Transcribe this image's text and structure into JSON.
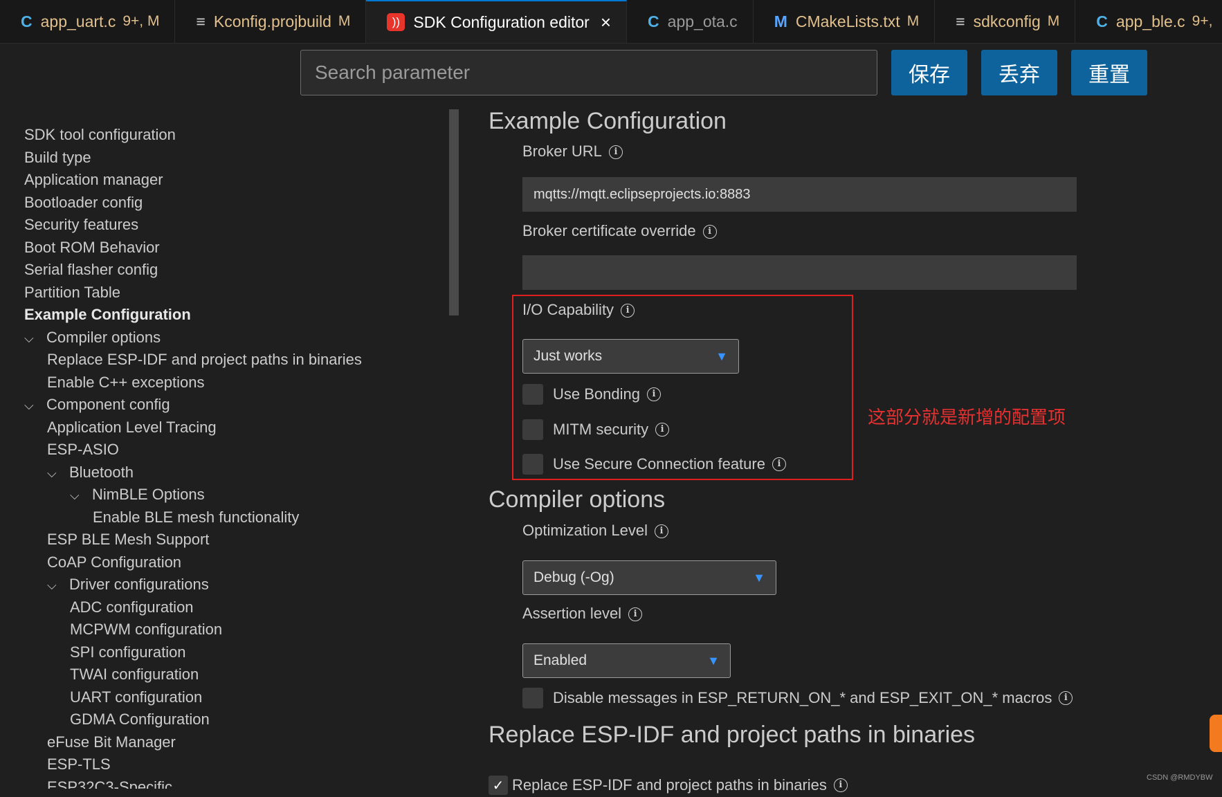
{
  "tabs": [
    {
      "icon": "C",
      "name": "app_uart.c",
      "modified": "9+, M"
    },
    {
      "icon": "≡",
      "name": "Kconfig.projbuild",
      "modified": "M"
    },
    {
      "icon": "esp",
      "name": "SDK Configuration editor",
      "close": "×"
    },
    {
      "icon": "C",
      "name": "app_ota.c"
    },
    {
      "icon": "M",
      "name": "CMakeLists.txt",
      "modified": "M"
    },
    {
      "icon": "≡",
      "name": "sdkconfig",
      "modified": "M"
    },
    {
      "icon": "C",
      "name": "app_ble.c",
      "modified": "9+,"
    }
  ],
  "toolbar": {
    "search_placeholder": "Search parameter",
    "save": "保存",
    "discard": "丢弃",
    "reset": "重置"
  },
  "sidebar": {
    "items": [
      {
        "label": "SDK tool configuration"
      },
      {
        "label": "Build type"
      },
      {
        "label": "Application manager"
      },
      {
        "label": "Bootloader config"
      },
      {
        "label": "Security features"
      },
      {
        "label": "Boot ROM Behavior"
      },
      {
        "label": "Serial flasher config"
      },
      {
        "label": "Partition Table"
      },
      {
        "label": "Example Configuration",
        "active": true
      },
      {
        "label": "Compiler options",
        "expanded": true
      },
      {
        "label": "Replace ESP-IDF and project paths in binaries"
      },
      {
        "label": "Enable C++ exceptions"
      },
      {
        "label": "Component config",
        "expanded": true
      },
      {
        "label": "Application Level Tracing"
      },
      {
        "label": "ESP-ASIO"
      },
      {
        "label": "Bluetooth",
        "expanded": true
      },
      {
        "label": "NimBLE Options",
        "expanded": true
      },
      {
        "label": "Enable BLE mesh functionality"
      },
      {
        "label": "ESP BLE Mesh Support"
      },
      {
        "label": "CoAP Configuration"
      },
      {
        "label": "Driver configurations",
        "expanded": true
      },
      {
        "label": "ADC configuration"
      },
      {
        "label": "MCPWM configuration"
      },
      {
        "label": "SPI configuration"
      },
      {
        "label": "TWAI configuration"
      },
      {
        "label": "UART configuration"
      },
      {
        "label": "GDMA Configuration"
      },
      {
        "label": "eFuse Bit Manager"
      },
      {
        "label": "ESP-TLS"
      },
      {
        "label": "ESP32C3-Specific"
      }
    ]
  },
  "main": {
    "example": {
      "title": "Example Configuration",
      "broker_url_label": "Broker URL",
      "broker_url_value": "mqtts://mqtt.eclipseprojects.io:8883",
      "broker_cert_label": "Broker certificate override",
      "broker_cert_value": "",
      "io_cap_label": "I/O Capability",
      "io_cap_value": "Just works",
      "use_bonding": "Use Bonding",
      "mitm": "MITM security",
      "secure_conn": "Use Secure Connection feature",
      "note": "这部分就是新增的配置项"
    },
    "compiler": {
      "title": "Compiler options",
      "opt_label": "Optimization Level",
      "opt_value": "Debug (-Og)",
      "assert_label": "Assertion level",
      "assert_value": "Enabled",
      "disable_msgs": "Disable messages in ESP_RETURN_ON_* and ESP_EXIT_ON_* macros"
    },
    "replace": {
      "title": "Replace ESP-IDF and project paths in binaries",
      "check_label": "Replace ESP-IDF and project paths in binaries"
    }
  },
  "watermark": "CSDN @RMDYBW",
  "icons": {
    "info": "info-icon",
    "chevron": "chevron-down-icon",
    "c_file": "c-file-icon",
    "list_file": "list-file-icon",
    "cmake": "cmake-icon",
    "espressif": "espressif-icon"
  },
  "colors": {
    "accent": "#0e639c",
    "highlight_box": "#e02020",
    "note_text": "#e83030",
    "background": "#1f1f1f"
  }
}
